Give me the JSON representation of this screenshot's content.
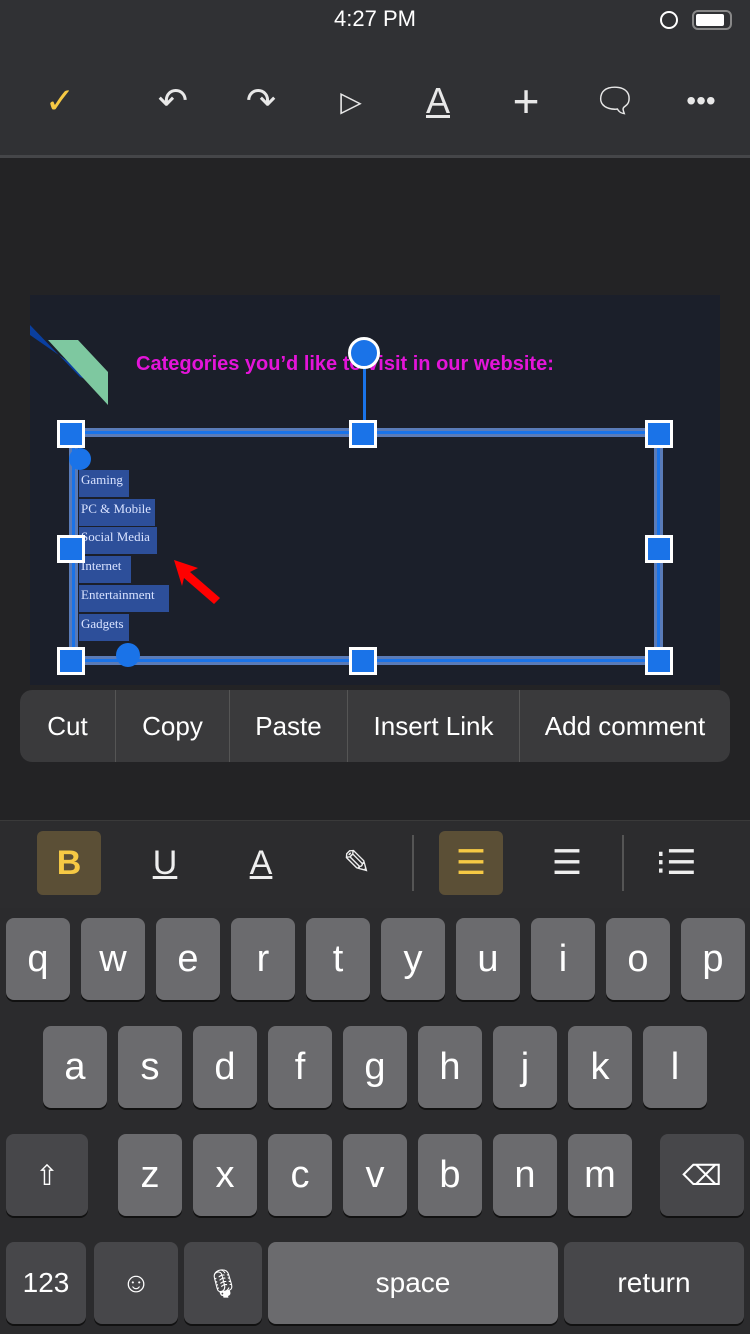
{
  "status": {
    "time": "4:27 PM"
  },
  "toolbar": {
    "icons": [
      "check-icon",
      "undo-icon",
      "redo-icon",
      "play-icon",
      "text-format-icon",
      "add-icon",
      "comment-icon",
      "more-icon"
    ],
    "accent": "#f6c944"
  },
  "slide": {
    "title": "Categories you’d like to visit in our website:",
    "items": [
      "Gaming",
      "PC & Mobile",
      "Social Media",
      "Internet",
      "Entertainment",
      "Gadgets"
    ],
    "title_color": "#e414d9"
  },
  "context_menu": [
    "Cut",
    "Copy",
    "Paste",
    "Insert Link",
    "Add comment"
  ],
  "format_bar": {
    "bold": "B",
    "underline": "U",
    "text_color": "A",
    "bold_active": true,
    "align_left_active": true
  },
  "keyboard": {
    "row1": [
      "q",
      "w",
      "e",
      "r",
      "t",
      "y",
      "u",
      "i",
      "o",
      "p"
    ],
    "row2": [
      "a",
      "s",
      "d",
      "f",
      "g",
      "h",
      "j",
      "k",
      "l"
    ],
    "row3": [
      "z",
      "x",
      "c",
      "v",
      "b",
      "n",
      "m"
    ],
    "numbers": "123",
    "space": "space",
    "return": "return"
  }
}
